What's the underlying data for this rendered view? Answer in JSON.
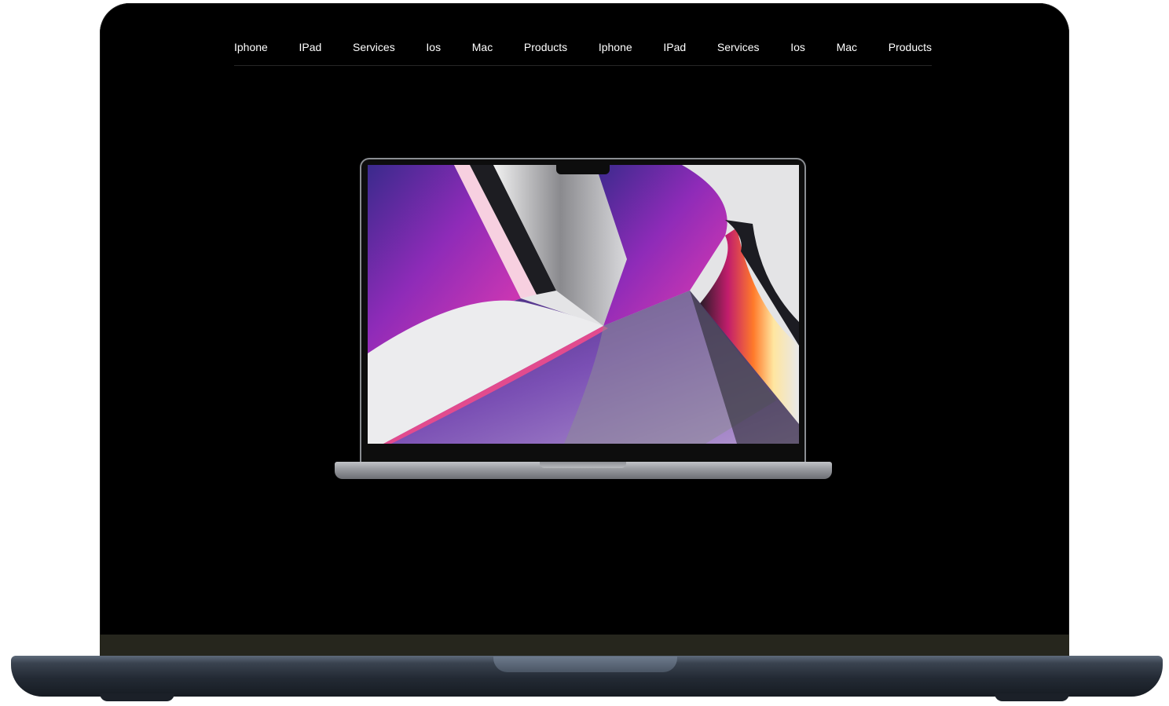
{
  "nav": {
    "items": [
      {
        "label": "Iphone"
      },
      {
        "label": "IPad"
      },
      {
        "label": "Services"
      },
      {
        "label": "Ios"
      },
      {
        "label": "Mac"
      },
      {
        "label": "Products"
      },
      {
        "label": "Iphone"
      },
      {
        "label": "IPad"
      },
      {
        "label": "Services"
      },
      {
        "label": "Ios"
      },
      {
        "label": "Mac"
      },
      {
        "label": "Products"
      }
    ]
  },
  "colors": {
    "background": "#000000",
    "nav_text": "#ffffff",
    "nav_divider": "#262626"
  },
  "hero": {
    "image": "macbook-pro-illustration"
  }
}
